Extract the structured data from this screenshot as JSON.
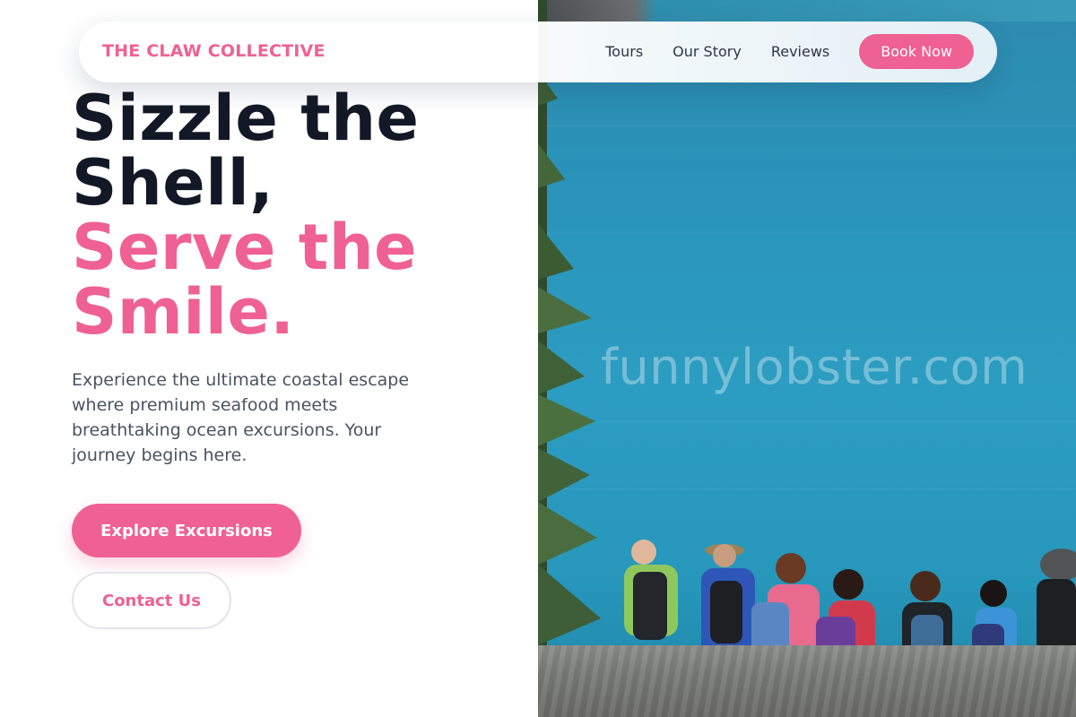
{
  "nav": {
    "brand": "THE CLAW COLLECTIVE",
    "links": [
      "Tours",
      "Our Story",
      "Reviews"
    ],
    "cta": "Book Now"
  },
  "hero": {
    "headline_dark": [
      "Sizzle the",
      "Shell,"
    ],
    "headline_accent": [
      "Serve the",
      "Smile."
    ],
    "description": "Experience the ultimate coastal escape where premium seafood meets breathtaking ocean excursions. Your journey begins here.",
    "primary_button": "Explore Excursions",
    "secondary_button": "Contact Us"
  },
  "image": {
    "watermark": "funnylobster.com"
  },
  "colors": {
    "accent": "#ef6192",
    "heading": "#121826",
    "body_text": "#4a5362",
    "nav_text": "#2d3645"
  }
}
